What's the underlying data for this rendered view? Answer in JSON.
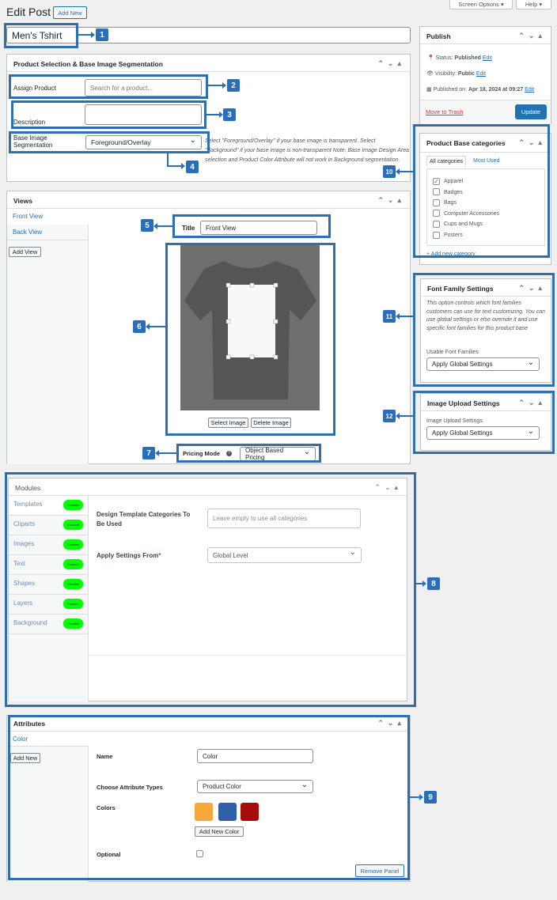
{
  "header": {
    "title": "Edit Post",
    "add_new": "Add New",
    "screen_options": "Screen Options ▾",
    "help": "Help ▾"
  },
  "post_title": "Men's Tshirt",
  "product_panel": {
    "title": "Product Selection & Base Image Segmentation",
    "assign_label": "Assign Product",
    "assign_placeholder": "Search for a product...",
    "description_label": "Description",
    "segmentation_label": "Base Image Segmentation",
    "segmentation_value": "Foreground/Overlay",
    "help_text": "Select \"Foreground/Overlay\" if your base image is transparent. Select \"Background\" if your base image is non-transparent Note: Base Image Design Area selection and Product Color Attribute will not work in Background segmentation."
  },
  "views_panel": {
    "title": "Views",
    "tabs": [
      "Front View",
      "Back View"
    ],
    "add_view": "Add View",
    "title_label": "Title",
    "title_value": "Front View",
    "select_image": "Select Image",
    "delete_image": "Delete Image",
    "pricing_label": "Pricing Mode",
    "pricing_value": "Object Based Pricing"
  },
  "modules_panel": {
    "title": "Modules",
    "tabs": [
      "Templates",
      "Cliparts",
      "Images",
      "Text",
      "Shapes",
      "Layers",
      "Background"
    ],
    "badge": "Enabled",
    "design_label": "Design Template Categories To Be Used",
    "design_placeholder": "Leave empty to use all categories",
    "apply_label": "Apply Settings From",
    "required_mark": "*",
    "apply_value": "Global Level"
  },
  "attributes_panel": {
    "title": "Attributes",
    "tab": "Color",
    "add_new": "Add New",
    "name_label": "Name",
    "name_value": "Color",
    "types_label": "Choose Attribute Types",
    "types_value": "Product Color",
    "colors_label": "Colors",
    "colors": [
      "#f5a83a",
      "#2f5fa7",
      "#a50d0d"
    ],
    "add_color": "Add New Color",
    "optional_label": "Optional",
    "remove_panel": "Remove Panel"
  },
  "publish": {
    "title": "Publish",
    "status_label": "Status:",
    "status": "Published",
    "visibility_label": "Visibility:",
    "visibility": "Public",
    "published_label": "Published on:",
    "published": "Apr 18, 2024 at 09:27",
    "edit": "Edit",
    "trash": "Move to Trash",
    "update": "Update"
  },
  "categories": {
    "title": "Product Base categories",
    "tab_all": "All categories",
    "tab_used": "Most Used",
    "items": [
      {
        "label": "Apparel",
        "checked": true
      },
      {
        "label": "Badges",
        "checked": false
      },
      {
        "label": "Bags",
        "checked": false
      },
      {
        "label": "Computer Accessories",
        "checked": false
      },
      {
        "label": "Cups and Mugs",
        "checked": false
      },
      {
        "label": "Posters",
        "checked": false
      }
    ],
    "add_new": "+ Add new category"
  },
  "font_panel": {
    "title": "Font Family Settings",
    "description": "This option controls which font families customers can use for text customizing. You can use global settings or else override it and use specific font families for this product base",
    "label": "Usable Font Families",
    "value": "Apply Global Settings"
  },
  "upload_panel": {
    "title": "Image Upload Settings",
    "label": "Image Upload Settings",
    "value": "Apply Global Settings"
  },
  "annotations": [
    "1",
    "2",
    "3",
    "4",
    "5",
    "6",
    "7",
    "8",
    "9",
    "10",
    "11",
    "12"
  ],
  "colors": {
    "accent": "#2271b1",
    "annotation": "#2a6ebb",
    "enabled": "#00ff00"
  }
}
